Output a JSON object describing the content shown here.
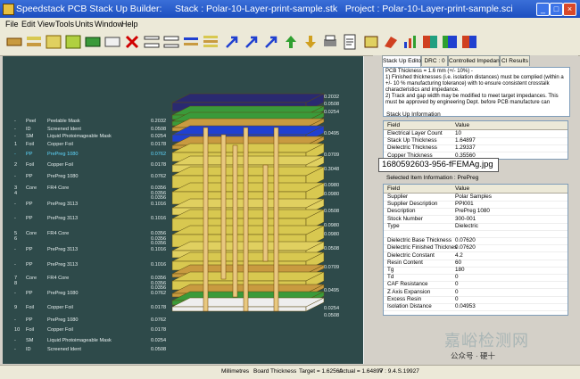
{
  "titlebar": {
    "app": "Speedstack PCB Stack Up Builder:",
    "stack": "Stack : Polar-10-Layer-print-sample.stk",
    "project": "Project : Polar-10-Layer-print-sample.sci"
  },
  "menu": [
    "File",
    "Edit",
    "View",
    "Tools",
    "Units",
    "Window",
    "Help"
  ],
  "layers": [
    {
      "code": "-",
      "abbr": "Peel",
      "name": "Peelable Mask",
      "thick": "0.2032"
    },
    {
      "code": "-",
      "abbr": "ID",
      "name": "Screened Ident",
      "thick": "0.0508"
    },
    {
      "code": "-",
      "abbr": "SM",
      "name": "Liquid Photoimageable Mask",
      "thick": "0.0254"
    },
    {
      "code": "1",
      "abbr": "Foil",
      "name": "Copper Foil",
      "thick": "0.0178"
    },
    {
      "code": "-",
      "abbr": "PP",
      "name": "PrePreg 1080",
      "thick": "0.0762",
      "selected": true
    },
    {
      "code": "2",
      "abbr": "Foil",
      "name": "Copper Foil",
      "thick": "0.0178"
    },
    {
      "code": "-",
      "abbr": "PP",
      "name": "PrePreg 1080",
      "thick": "0.0762"
    },
    {
      "code": "3\n4",
      "abbr": "Core",
      "name": "FR4 Core",
      "thick": "0.0356\n0.0356\n0.0356"
    },
    {
      "code": "-",
      "abbr": "PP",
      "name": "PrePreg 3113",
      "thick": "0.1016"
    },
    {
      "code": "-",
      "abbr": "PP",
      "name": "PrePreg 3113",
      "thick": "0.1016"
    },
    {
      "code": "5\n6",
      "abbr": "Core",
      "name": "FR4 Core",
      "thick": "0.0356\n0.0356\n0.0356"
    },
    {
      "code": "-",
      "abbr": "PP",
      "name": "PrePreg 3113",
      "thick": "0.1016"
    },
    {
      "code": "-",
      "abbr": "PP",
      "name": "PrePreg 3113",
      "thick": "0.1016"
    },
    {
      "code": "7\n8",
      "abbr": "Core",
      "name": "FR4 Core",
      "thick": "0.0356\n0.0356\n0.0356"
    },
    {
      "code": "-",
      "abbr": "PP",
      "name": "PrePreg 1080",
      "thick": "0.0762"
    },
    {
      "code": "9",
      "abbr": "Foil",
      "name": "Copper Foil",
      "thick": "0.0178"
    },
    {
      "code": "-",
      "abbr": "PP",
      "name": "PrePreg 1080",
      "thick": "0.0762"
    },
    {
      "code": "10",
      "abbr": "Foil",
      "name": "Copper Foil",
      "thick": "0.0178"
    },
    {
      "code": "-",
      "abbr": "SM",
      "name": "Liquid Photoimageable Mask",
      "thick": "0.0254"
    },
    {
      "code": "-",
      "abbr": "ID",
      "name": "Screened Ident",
      "thick": "0.0508"
    }
  ],
  "right_thicknesses": [
    "0.2032",
    "0.0508",
    "0.0254",
    "0.0495",
    "0.0709",
    "0.3048",
    "0.0980",
    "0.0980",
    "0.0508",
    "0.0980",
    "0.0980",
    "0.0508",
    "0.0709",
    "0.0495",
    "0.0254",
    "0.0508"
  ],
  "tabs": [
    "Stack Up Editor",
    "DRC : 0",
    "Controlled Impedance",
    "CI Results"
  ],
  "notes": "PCB Thickness = 1.6 mm (+/- 10%) -\n1) Finished thicknesses (i.e. isolation distances) must be complied (within a +/- 10 % manufacturing tolerance) with to ensure consistent crosstalk characteristics and impedance.\n2) Track and gap width may be modified to meet target impedances. This must be approved by engineering Dept. before PCB manufacture can",
  "stackup_info": {
    "title": "Stack Up Information",
    "headers": [
      "Field",
      "Value"
    ],
    "rows": [
      [
        "Electrical Layer Count",
        "10"
      ],
      [
        "Stack Up Thickness",
        "1.64897"
      ],
      [
        "Dielectric Thickness",
        "1.29337"
      ],
      [
        "Copper Thickness",
        "0.35560"
      ]
    ]
  },
  "selected_info": {
    "title": "Selected Item Information : PrePreg",
    "headers": [
      "Field",
      "Value"
    ],
    "rows": [
      [
        "Supplier",
        "Polar Samples"
      ],
      [
        "Supplier Description",
        "PPI001"
      ],
      [
        "Description",
        "PrePreg 1080"
      ],
      [
        "Stock Number",
        "300-001"
      ],
      [
        "Type",
        "Dielectric"
      ],
      [
        "",
        ""
      ],
      [
        "Dielectric Base Thickness",
        "0.07620"
      ],
      [
        "Dielectric Finished Thicknes",
        "0.07620"
      ],
      [
        "Dielectric Constant",
        "4.2"
      ],
      [
        "Resin Content",
        "60"
      ],
      [
        "Tg",
        "180"
      ],
      [
        "Td",
        "0"
      ],
      [
        "CAF Resistance",
        "0"
      ],
      [
        "Z Axis Expansion",
        "0"
      ],
      [
        "Excess Resin",
        "0"
      ],
      [
        "Isolation Distance",
        "0.04953"
      ]
    ]
  },
  "tooltip": "1680592603-956-fFEMAg.jpg",
  "status": {
    "units": "Millimetres",
    "board": "Board Thickness",
    "target": "Target =  1.62560",
    "actual": "Actual =  1.64897",
    "version": "V : 9.4.S.19927"
  },
  "watermark": "嘉峪检测网",
  "watermark2": "公众号 · 硬十",
  "colors": {
    "canvas": "#2e4a4a",
    "copper": "#c89a40",
    "prepreg": "#d8c850",
    "core": "#e0d060",
    "selected": "#2040d0",
    "mask": "#3a9a3a",
    "peel": "#2a2a70"
  }
}
